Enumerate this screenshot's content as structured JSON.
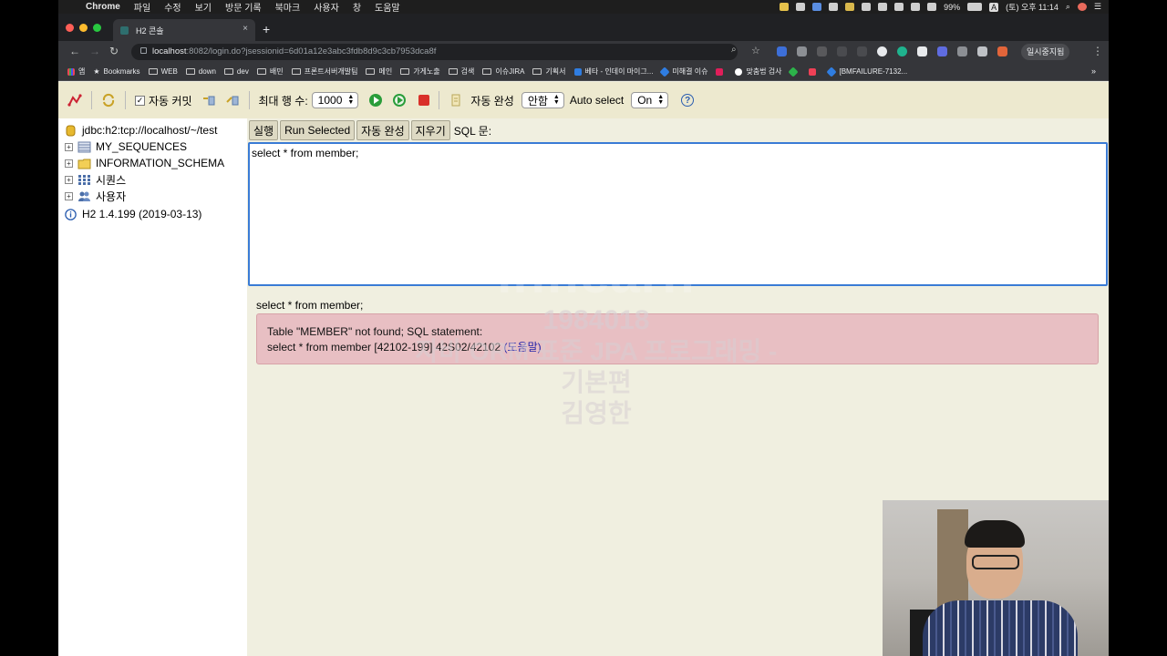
{
  "menubar": {
    "items": [
      "Chrome",
      "파일",
      "수정",
      "보기",
      "방문 기록",
      "북마크",
      "사용자",
      "창",
      "도움말"
    ],
    "battery": "99%",
    "clock": "(토) 오후 11:14",
    "input_source": "A"
  },
  "browser": {
    "tab_title": "H2 콘솔",
    "url_host": "localhost",
    "url_rest": ":8082/login.do?jsessionid=6d01a12e3abc3fdb8d9c3cb7953dca8f",
    "profile_button": "일시중지됨"
  },
  "bookmarks": [
    {
      "label": "앱",
      "kind": "apps"
    },
    {
      "label": "Bookmarks",
      "kind": "star"
    },
    {
      "label": "WEB",
      "kind": "folder"
    },
    {
      "label": "down",
      "kind": "folder"
    },
    {
      "label": "dev",
      "kind": "folder"
    },
    {
      "label": "배민",
      "kind": "folder"
    },
    {
      "label": "프론트서버개발팀",
      "kind": "folder"
    },
    {
      "label": "메인",
      "kind": "folder"
    },
    {
      "label": "가게노출",
      "kind": "folder"
    },
    {
      "label": "검색",
      "kind": "folder"
    },
    {
      "label": "이슈JIRA",
      "kind": "folder"
    },
    {
      "label": "기획서",
      "kind": "folder"
    },
    {
      "label": "베타 - 인데이 마이그...",
      "kind": "confluence"
    },
    {
      "label": "미해결 이슈",
      "kind": "jira"
    },
    {
      "label": "",
      "kind": "slack"
    },
    {
      "label": "맞춤법 검사",
      "kind": "google"
    },
    {
      "label": "",
      "kind": "green"
    },
    {
      "label": "",
      "kind": "pocket"
    },
    {
      "label": "[BMFAILURE-7132...",
      "kind": "jira"
    }
  ],
  "toolbar": {
    "autocommit_label": "자동 커밋",
    "autocommit_checked": true,
    "max_rows_label": "최대 행 수:",
    "max_rows_value": "1000",
    "autocomplete_label": "자동 완성",
    "autocomplete_value": "안함",
    "autoselect_label": "Auto select",
    "autoselect_value": "On"
  },
  "tree": {
    "connection": "jdbc:h2:tcp://localhost/~/test",
    "nodes": [
      "MY_SEQUENCES",
      "INFORMATION_SCHEMA",
      "시퀀스",
      "사용자"
    ],
    "version": "H2 1.4.199 (2019-03-13)"
  },
  "sql": {
    "run_label": "실행",
    "run_selected_label": "Run Selected",
    "autocomplete_label": "자동 완성",
    "clear_label": "지우기",
    "statement_label": "SQL 문:",
    "editor_text": "select * from member;"
  },
  "result": {
    "statement": "select * from member;",
    "error_line1": "Table \"MEMBER\" not found; SQL statement:",
    "error_line2": "select * from member [42102-199] 42S02/42102",
    "help_link": "(도움말)"
  },
  "watermark": {
    "logo": "inflearn",
    "id": "1984018",
    "course": "자바 ORM 표준 JPA 프로그래밍 - 기본편",
    "instructor": "김영한"
  }
}
